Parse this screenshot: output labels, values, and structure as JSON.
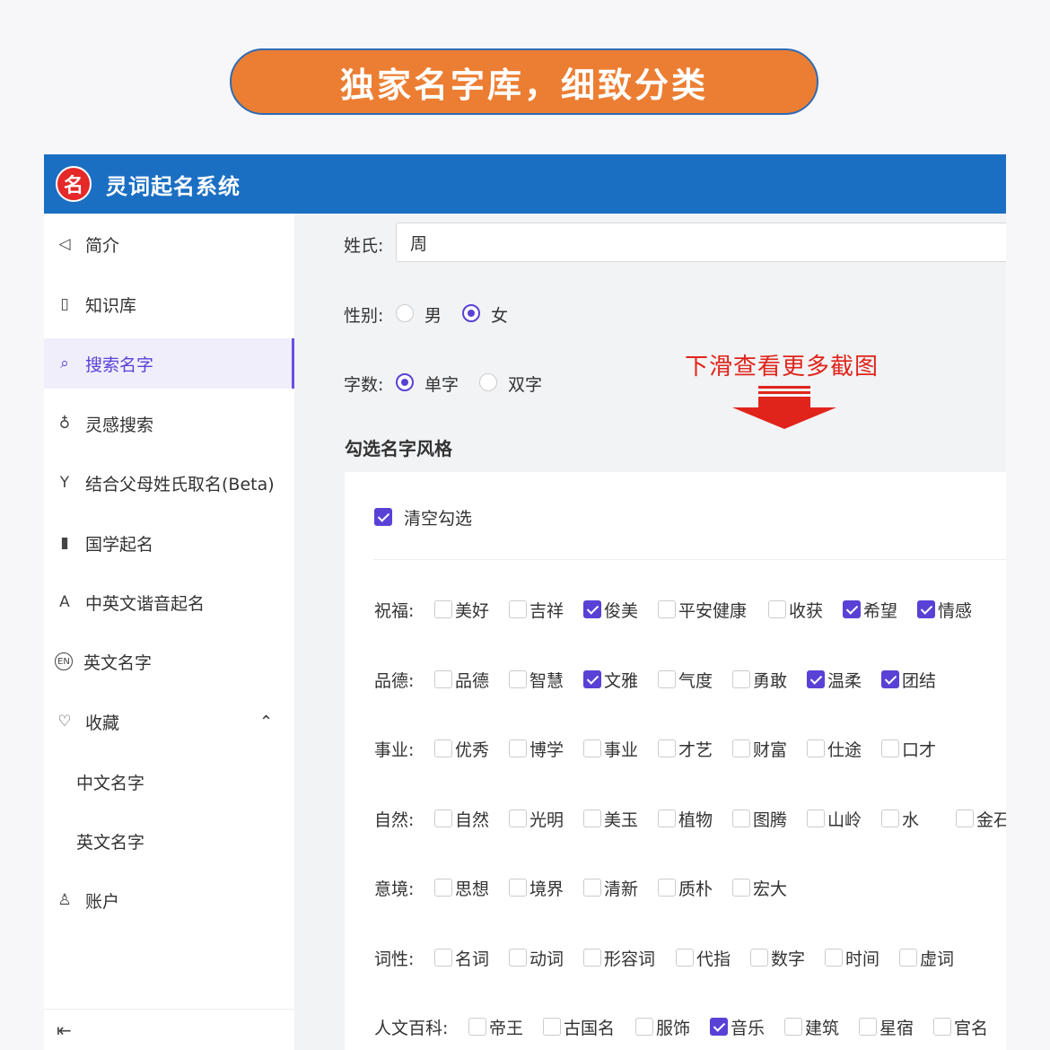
{
  "banner": {
    "title": "独家名字库，细致分类"
  },
  "header": {
    "logo_char": "名",
    "app_title": "灵词起名系统"
  },
  "sidebar": {
    "items": [
      {
        "label": "简介",
        "icon": "megaphone-icon",
        "glyph": "◁"
      },
      {
        "label": "知识库",
        "icon": "book-icon",
        "glyph": "▯"
      },
      {
        "label": "搜索名字",
        "icon": "search-icon",
        "glyph": "⌕",
        "active": true
      },
      {
        "label": "灵感搜索",
        "icon": "bulb-icon",
        "glyph": "♁"
      },
      {
        "label": "结合父母姓氏取名(Beta)",
        "icon": "fork-icon",
        "glyph": "Y"
      },
      {
        "label": "国学起名",
        "icon": "scroll-icon",
        "glyph": "▮"
      },
      {
        "label": "中英文谐音起名",
        "icon": "font-icon",
        "glyph": "A"
      },
      {
        "label": "英文名字",
        "icon": "en-icon",
        "glyph": "EN"
      },
      {
        "label": "收藏",
        "icon": "heart-icon",
        "glyph": "♡"
      }
    ],
    "favorites_sub": [
      "中文名字",
      "英文名字"
    ],
    "account": {
      "label": "账户",
      "icon": "user-icon",
      "glyph": "♙"
    },
    "collapse_glyph": "⇤"
  },
  "form": {
    "surname_label": "姓氏:",
    "surname_value": "周",
    "gender_label": "性别:",
    "gender_options": [
      "男",
      "女"
    ],
    "gender_selected": "女",
    "count_label": "字数:",
    "count_options": [
      "单字",
      "双字"
    ],
    "count_selected": "单字",
    "hint": "下滑查看更多截图",
    "style_title": "勾选名字风格",
    "clear_label": "清空勾选",
    "clear_checked": true
  },
  "categories": [
    {
      "label": "祝福:",
      "options": [
        {
          "text": "美好",
          "checked": false
        },
        {
          "text": "吉祥",
          "checked": false
        },
        {
          "text": "俊美",
          "checked": true
        },
        {
          "text": "平安健康",
          "checked": false
        },
        {
          "text": "收获",
          "checked": false
        },
        {
          "text": "希望",
          "checked": true
        },
        {
          "text": "情感",
          "checked": true
        }
      ]
    },
    {
      "label": "品德:",
      "options": [
        {
          "text": "品德",
          "checked": false
        },
        {
          "text": "智慧",
          "checked": false
        },
        {
          "text": "文雅",
          "checked": true
        },
        {
          "text": "气度",
          "checked": false
        },
        {
          "text": "勇敢",
          "checked": false
        },
        {
          "text": "温柔",
          "checked": true
        },
        {
          "text": "团结",
          "checked": true
        }
      ]
    },
    {
      "label": "事业:",
      "options": [
        {
          "text": "优秀",
          "checked": false
        },
        {
          "text": "博学",
          "checked": false
        },
        {
          "text": "事业",
          "checked": false
        },
        {
          "text": "才艺",
          "checked": false
        },
        {
          "text": "财富",
          "checked": false
        },
        {
          "text": "仕途",
          "checked": false
        },
        {
          "text": "口才",
          "checked": false
        }
      ]
    },
    {
      "label": "自然:",
      "options": [
        {
          "text": "自然",
          "checked": false
        },
        {
          "text": "光明",
          "checked": false
        },
        {
          "text": "美玉",
          "checked": false
        },
        {
          "text": "植物",
          "checked": false
        },
        {
          "text": "图腾",
          "checked": false
        },
        {
          "text": "山岭",
          "checked": false
        },
        {
          "text": "水",
          "checked": false
        },
        {
          "text": "金石",
          "checked": false
        }
      ]
    },
    {
      "label": "意境:",
      "options": [
        {
          "text": "思想",
          "checked": false
        },
        {
          "text": "境界",
          "checked": false
        },
        {
          "text": "清新",
          "checked": false
        },
        {
          "text": "质朴",
          "checked": false
        },
        {
          "text": "宏大",
          "checked": false
        }
      ]
    },
    {
      "label": "词性:",
      "options": [
        {
          "text": "名词",
          "checked": false
        },
        {
          "text": "动词",
          "checked": false
        },
        {
          "text": "形容词",
          "checked": false
        },
        {
          "text": "代指",
          "checked": false
        },
        {
          "text": "数字",
          "checked": false
        },
        {
          "text": "时间",
          "checked": false
        },
        {
          "text": "虚词",
          "checked": false
        }
      ]
    },
    {
      "label": "人文百科:",
      "options": [
        {
          "text": "帝王",
          "checked": false
        },
        {
          "text": "古国名",
          "checked": false
        },
        {
          "text": "服饰",
          "checked": false
        },
        {
          "text": "音乐",
          "checked": true
        },
        {
          "text": "建筑",
          "checked": false
        },
        {
          "text": "星宿",
          "checked": false
        },
        {
          "text": "官名",
          "checked": false
        }
      ]
    }
  ],
  "colors": {
    "accent": "#5a41d6",
    "header": "#1b6fc3",
    "banner": "#ec7e33",
    "hint": "#e0241b"
  }
}
